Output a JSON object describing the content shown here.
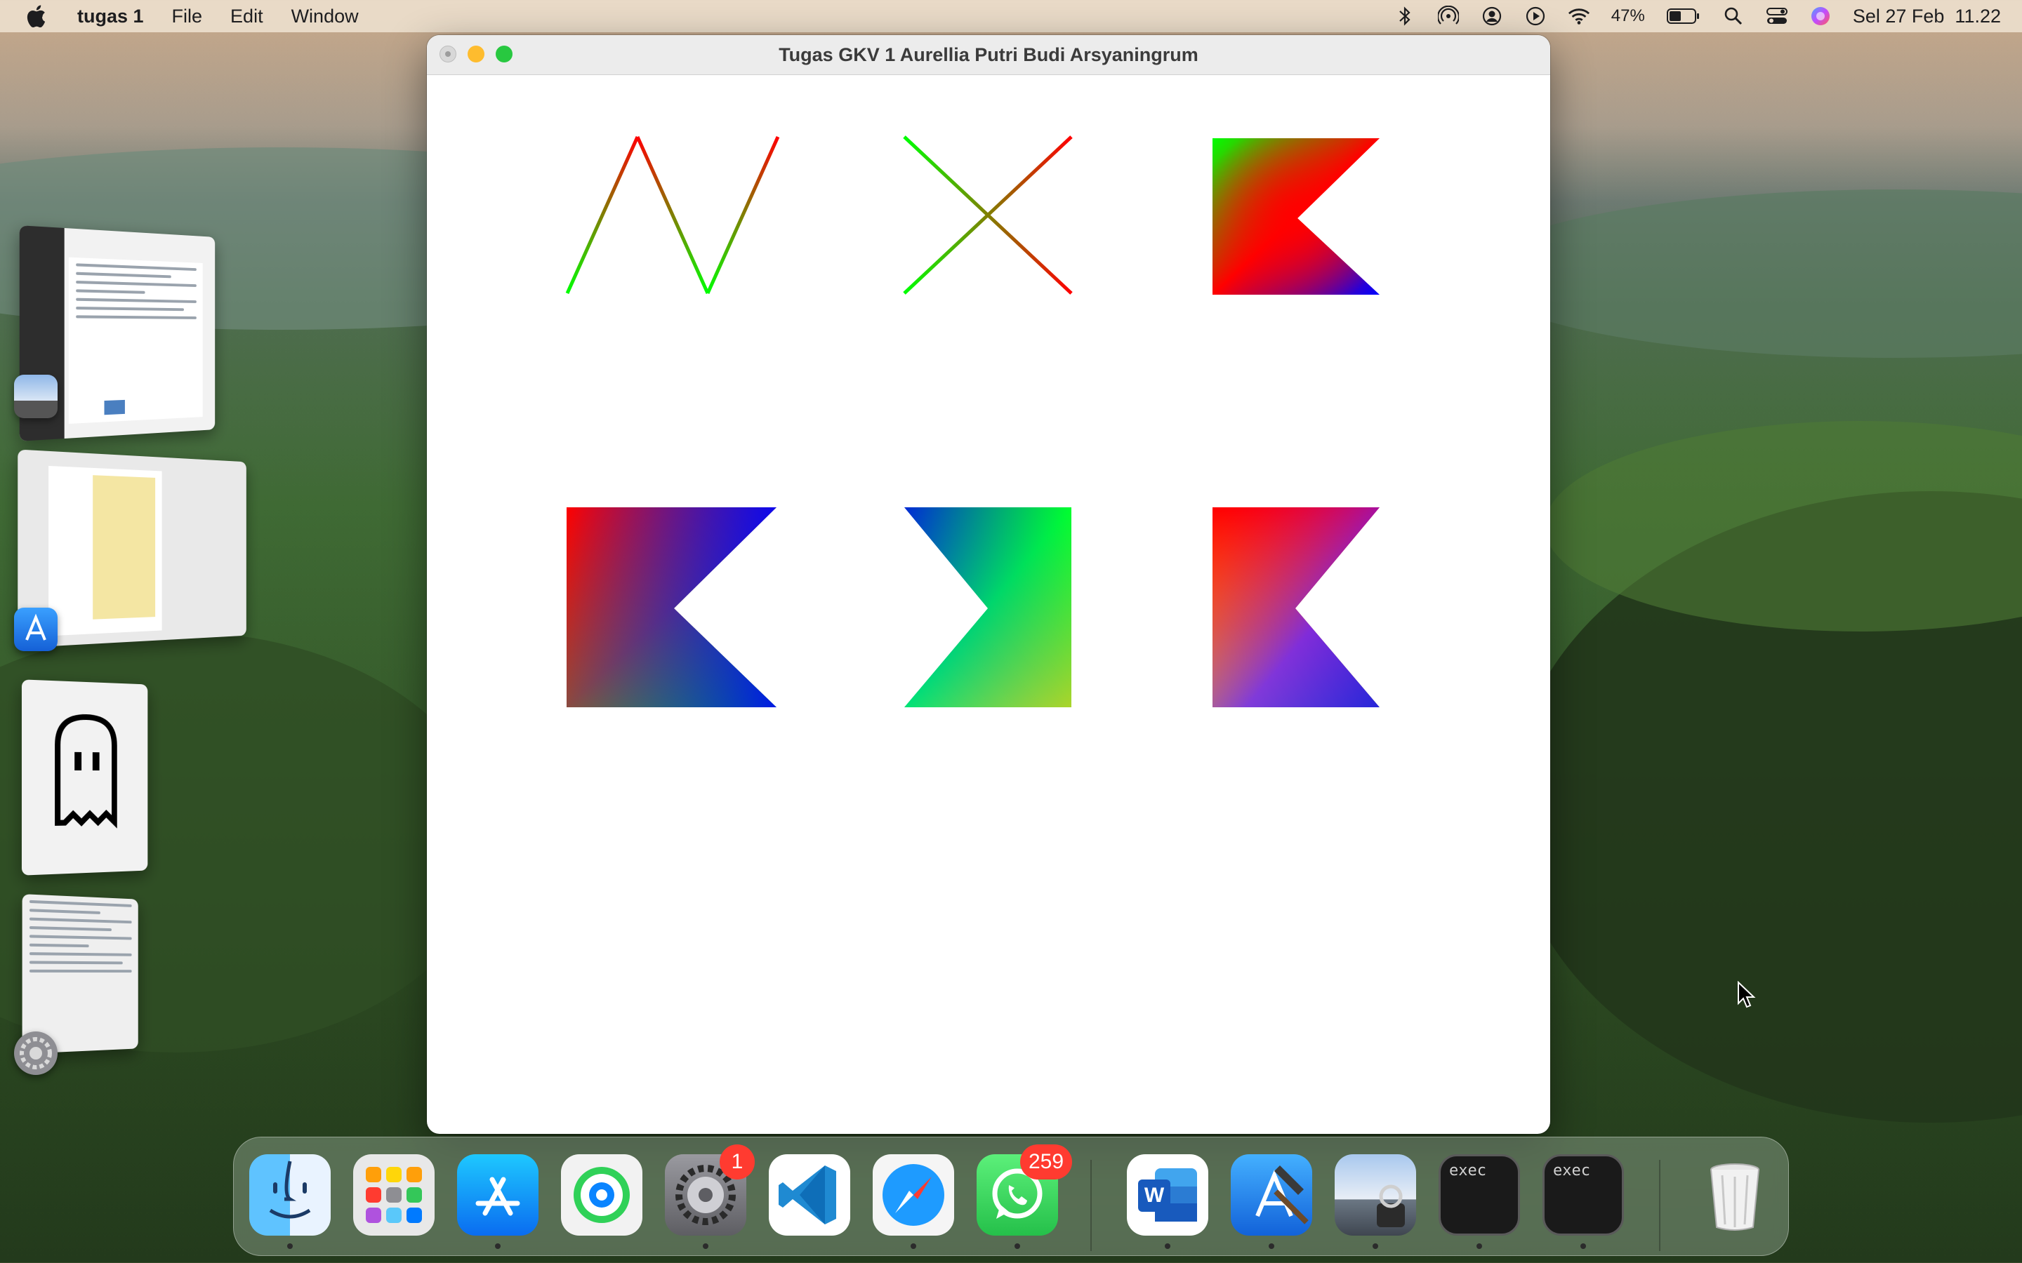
{
  "menubar": {
    "apple_icon": "apple-logo-icon",
    "app_name": "tugas 1",
    "items": [
      "File",
      "Edit",
      "Window"
    ],
    "status": {
      "battery_percent": "47%",
      "datetime": "Sel 27 Feb  11.22"
    }
  },
  "window": {
    "title": "Tugas GKV 1 Aurellia Putri Budi Arsyaningrum"
  },
  "dock": {
    "whatsapp_badge": "259",
    "settings_badge": "1",
    "exec1_label": "exec",
    "exec2_label": "exec"
  },
  "colors": {
    "red": "#ff0000",
    "green": "#00ff00",
    "blue": "#0000ff",
    "yellow": "#ffff00"
  }
}
